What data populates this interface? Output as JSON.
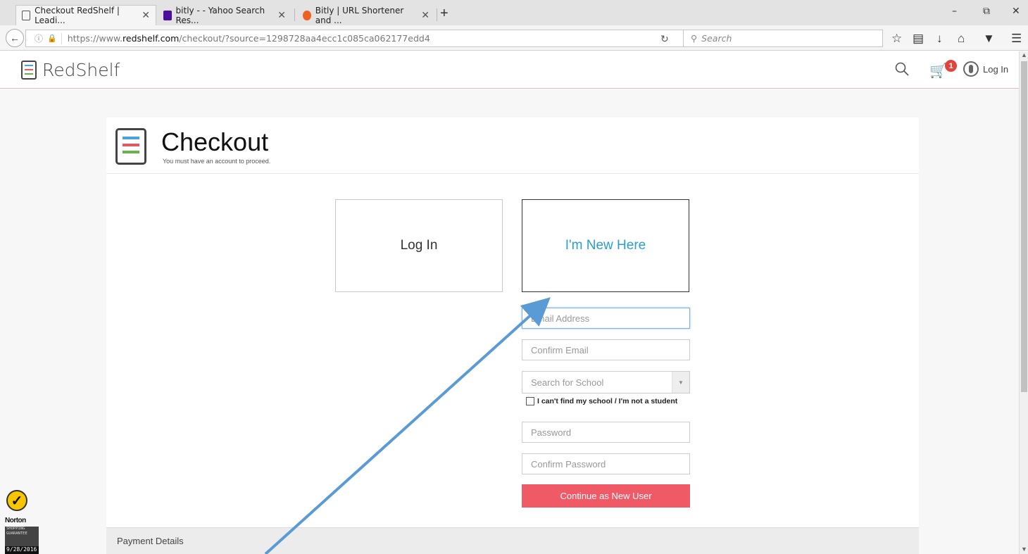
{
  "browser": {
    "tabs": [
      {
        "label": "Checkout RedShelf | Leadi...",
        "close": "✕",
        "active": true
      },
      {
        "label": "bitly - - Yahoo Search Res...",
        "close": "✕",
        "active": false
      },
      {
        "label": "Bitly | URL Shortener and ...",
        "close": "✕",
        "active": false
      }
    ],
    "new_tab": "+",
    "url_gray": "https://www.",
    "url_dark": "redshelf.com",
    "url_rest": "/checkout/?source=1298728aa4ecc1c085ca062177edd4",
    "search_placeholder": "Search",
    "window_minimize": "–",
    "window_restore": "⧉",
    "window_close": "✕"
  },
  "site": {
    "name": "RedShelf",
    "cart_count": "1",
    "login_label": "Log In",
    "logo_colors": [
      "#4aa3d8",
      "#e05b5b",
      "#6ab04c"
    ]
  },
  "checkout": {
    "title": "Checkout",
    "subtitle": "You must have an account to proceed.",
    "login_option": "Log In",
    "new_option": "I'm New Here",
    "email_placeholder": "Email Address",
    "confirm_email_placeholder": "Confirm Email",
    "school_placeholder": "Search for School",
    "cant_find_school": "I can't find my school / I'm not a student",
    "password_placeholder": "Password",
    "confirm_password_placeholder": "Confirm Password",
    "continue_button": "Continue as New User",
    "payment_section": "Payment Details"
  },
  "norton": {
    "brand": "Norton",
    "guarantee": "SHOPPING GUARANTEE",
    "date": "9/28/2016"
  },
  "colors": {
    "accent_blue": "#2a9fc9",
    "button_red": "#f05a66",
    "arrow_blue": "#5b9bd5"
  }
}
